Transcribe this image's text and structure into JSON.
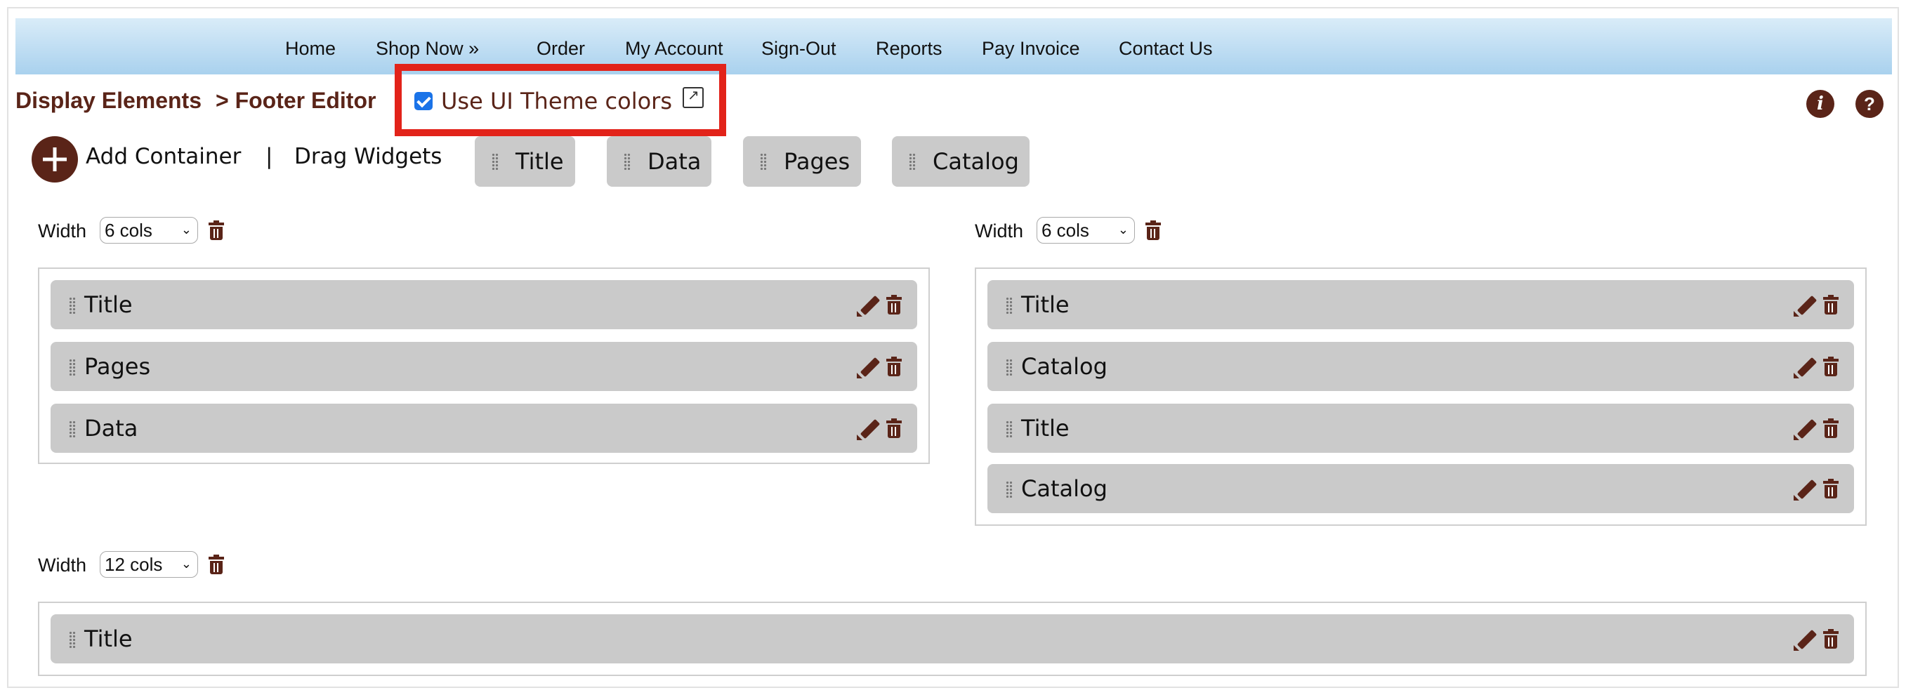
{
  "nav": {
    "items": [
      "Home",
      "Shop Now »",
      "Order",
      "My Account",
      "Sign-Out",
      "Reports",
      "Pay Invoice",
      "Contact Us"
    ]
  },
  "header": {
    "breadcrumb_root": "Display Elements",
    "breadcrumb_current": "> Footer Editor",
    "theme_checkbox_label": "Use UI Theme colors",
    "theme_checkbox_checked": true
  },
  "toolbar": {
    "add_container_label": "Add Container",
    "separator": "|",
    "drag_widgets_label": "Drag Widgets",
    "widgets": [
      "Title",
      "Data",
      "Pages",
      "Catalog"
    ]
  },
  "containers": [
    {
      "width_label": "Width",
      "width_value": "6 cols",
      "widgets": [
        "Title",
        "Pages",
        "Data"
      ]
    },
    {
      "width_label": "Width",
      "width_value": "6 cols",
      "widgets": [
        "Title",
        "Catalog",
        "Title",
        "Catalog"
      ]
    },
    {
      "width_label": "Width",
      "width_value": "12 cols",
      "widgets": [
        "Title"
      ]
    }
  ],
  "colors": {
    "accent": "#5a2418",
    "highlight_box": "#e2231a",
    "nav_gradient_top": "#d9ecf8",
    "nav_gradient_bottom": "#a9d1ee",
    "widget_bg": "#cacaca"
  }
}
